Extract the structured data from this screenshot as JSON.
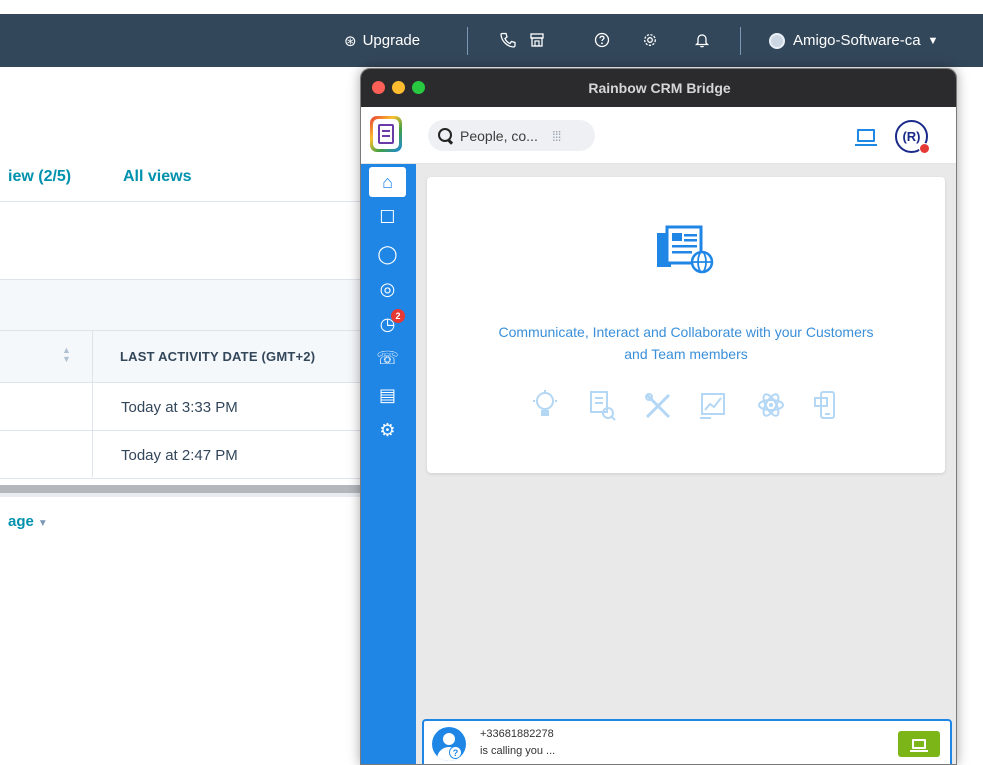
{
  "topbar": {
    "upgrade_label": "Upgrade",
    "upgrade_icon": "upgrade-icon",
    "icons": [
      "phone-icon",
      "marketplace-icon",
      "help-icon",
      "settings-icon",
      "bell-icon"
    ],
    "account_name": "Amigo-Software-ca",
    "colors": {
      "background": "#33475b",
      "text": "#ffffff"
    }
  },
  "crm": {
    "tabs": [
      "iew (2/5)",
      "All views"
    ],
    "table": {
      "column_header": "LAST ACTIVITY DATE (GMT+2)",
      "rows": [
        "Today at 3:33 PM",
        "Today at 2:47 PM"
      ]
    },
    "pagination_label": "age",
    "colors": {
      "link": "#0091ae"
    }
  },
  "rainbow": {
    "window_title": "Rainbow CRM Bridge",
    "search_placeholder": "People, co...",
    "avatar_initials": "(R)",
    "nav": [
      {
        "name": "home-icon",
        "glyph": "⌂"
      },
      {
        "name": "conversations-icon",
        "glyph": "☐"
      },
      {
        "name": "bubbles-icon",
        "glyph": "◯"
      },
      {
        "name": "contacts-icon",
        "glyph": "◎"
      },
      {
        "name": "recent-calls-icon",
        "glyph": "◷"
      },
      {
        "name": "phone-star-icon",
        "glyph": "☏"
      },
      {
        "name": "notes-icon",
        "glyph": "▤"
      },
      {
        "name": "settings-icon",
        "glyph": "⚙"
      }
    ],
    "missed_calls_badge": "2",
    "welcome_text_line1": "Communicate, Interact and Collaborate with your Customers",
    "welcome_text_line2": "and Team members",
    "feature_icons": [
      "idea-icon",
      "analytics-icon",
      "tools-icon",
      "chart-icon",
      "atom-icon",
      "mobile-icon"
    ],
    "incoming_call": {
      "number": "+33681882278",
      "status": "is calling you ..."
    },
    "colors": {
      "accent": "#1f86e6",
      "answer_button": "#7cb518",
      "titlebar": "#2b2b2d"
    }
  }
}
